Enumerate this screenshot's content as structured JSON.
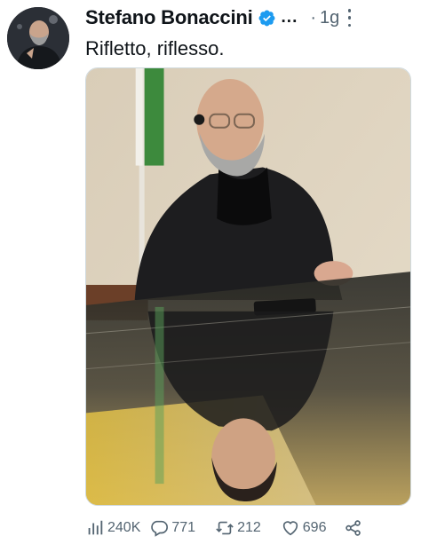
{
  "tweet": {
    "author_name": "Stefano Bonaccini",
    "ellipsis": "...",
    "separator": "·",
    "time": "1g",
    "text": "Rifletto, riflesso.",
    "verified": true
  },
  "actions": {
    "views": "240K",
    "replies": "771",
    "retweets": "212",
    "likes": "696"
  },
  "icons": {
    "verified": "verified-badge-icon",
    "more": "more-vertical-icon",
    "views": "views-chart-icon",
    "reply": "reply-bubble-icon",
    "retweet": "retweet-icon",
    "like": "heart-icon",
    "share": "share-icon"
  },
  "colors": {
    "verified_blue": "#1d9bf0",
    "secondary_text": "#536471",
    "primary_text": "#0f1419"
  }
}
